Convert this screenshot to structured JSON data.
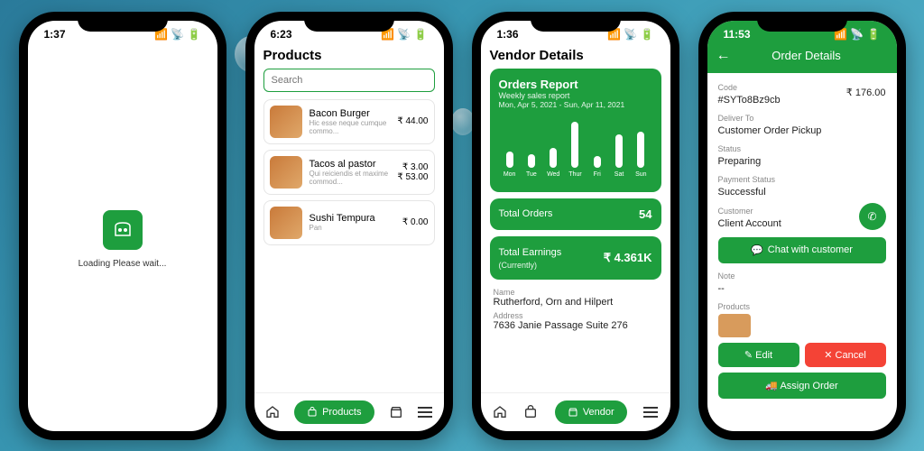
{
  "screen1": {
    "time": "1:37",
    "loading": "Loading Please wait..."
  },
  "screen2": {
    "time": "6:23",
    "title": "Products",
    "search_ph": "Search",
    "items": [
      {
        "name": "Bacon Burger",
        "sub": "Hic esse neque cumque commo...",
        "p1": "₹ 44.00"
      },
      {
        "name": "Tacos al pastor",
        "sub": "Qui reiciendis et maxime commod...",
        "p1": "₹ 3.00",
        "p2": "₹ 53.00"
      },
      {
        "name": "Sushi Tempura",
        "sub": "Pan",
        "p1": "₹ 0.00"
      }
    ],
    "nav_active": "Products"
  },
  "screen3": {
    "time": "1:36",
    "title": "Vendor Details",
    "report_title": "Orders Report",
    "report_sub": "Weekly sales report",
    "report_range": "Mon, Apr 5, 2021 - Sun, Apr 11, 2021",
    "days": [
      "Mon",
      "Tue",
      "Wed",
      "Thur",
      "Fri",
      "Sat",
      "Sun"
    ],
    "totals_label": "Total Orders",
    "totals_val": "54",
    "earn_label": "Total Earnings",
    "earn_sub": "(Currently)",
    "earn_val": "₹ 4.361K",
    "name_lbl": "Name",
    "name": "Rutherford, Orn and Hilpert",
    "addr_lbl": "Address",
    "addr": "7636 Janie Passage Suite 276",
    "nav_active": "Vendor"
  },
  "screen4": {
    "time": "11:53",
    "title": "Order Details",
    "code_lbl": "Code",
    "code": "#SYTo8Bz9cb",
    "total": "₹ 176.00",
    "deliver_lbl": "Deliver To",
    "deliver": "Customer Order Pickup",
    "status_lbl": "Status",
    "status": "Preparing",
    "pay_lbl": "Payment Status",
    "pay": "Successful",
    "cust_lbl": "Customer",
    "cust": "Client Account",
    "chat": "Chat with customer",
    "note_lbl": "Note",
    "note": "--",
    "prod_lbl": "Products",
    "edit": "Edit",
    "cancel": "Cancel",
    "assign": "Assign Order"
  },
  "chart_data": {
    "type": "bar",
    "title": "Orders Report",
    "categories": [
      "Mon",
      "Tue",
      "Wed",
      "Thur",
      "Fri",
      "Sat",
      "Sun"
    ],
    "values": [
      10,
      8,
      12,
      28,
      7,
      20,
      22
    ],
    "ylim": [
      0,
      30
    ]
  }
}
